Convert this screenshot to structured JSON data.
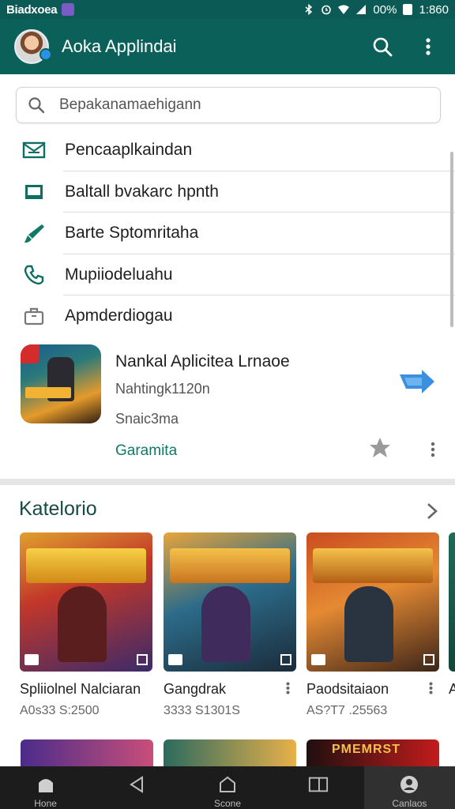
{
  "statusbar": {
    "carrier": "Biadxoea",
    "battery": "00%",
    "time": "1:860"
  },
  "appbar": {
    "title": "Aoka Applindai"
  },
  "search": {
    "placeholder": "Bepakanamaehigann"
  },
  "menu": {
    "items": [
      {
        "label": "Pencaaplkaindan",
        "icon": "mail-icon"
      },
      {
        "label": "Baltall bvakarc hpnth",
        "icon": "tablet-icon"
      },
      {
        "label": "Barte Sptomritaha",
        "icon": "brush-icon"
      },
      {
        "label": "Mupiiodeluahu",
        "icon": "phone-icon"
      },
      {
        "label": "Apmderdiogau",
        "icon": "briefcase-icon"
      }
    ]
  },
  "featured": {
    "title": "Nankal Aplicitea Lrnaoe",
    "subtitle": "Nahtingk1120n",
    "meta": "Snaic3ma",
    "action": "Garamita"
  },
  "categories": {
    "title": "Katelorio",
    "cards": [
      {
        "name": "Spliiolnel Nalciaran",
        "meta": "A0s33 S:2500"
      },
      {
        "name": "Gangdrak",
        "meta": "3333 S1301S"
      },
      {
        "name": "Paodsitaiaon",
        "meta": "AS?T7 .25563"
      },
      {
        "name": "A",
        "meta": ""
      }
    ],
    "peek_text": "PMEMRST"
  },
  "navbar": {
    "items": [
      {
        "label": "Hone",
        "icon": "home-icon"
      },
      {
        "label": "",
        "icon": "back-icon"
      },
      {
        "label": "Scone",
        "icon": "home-outline-icon"
      },
      {
        "label": "",
        "icon": "recents-icon"
      },
      {
        "label": "Canlaos",
        "icon": "profile-icon"
      }
    ]
  },
  "colors": {
    "primary": "#0b6159",
    "accent": "#0f7a66",
    "share": "#2a90e8",
    "navbar": "#1c1c1c"
  }
}
